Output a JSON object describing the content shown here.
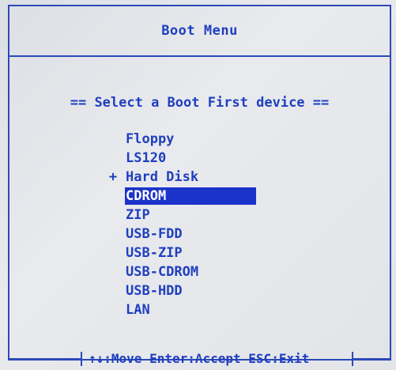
{
  "window": {
    "title": "Boot Menu"
  },
  "heading": "== Select a Boot First device ==",
  "devices": [
    {
      "label": "Floppy",
      "marker": ""
    },
    {
      "label": "LS120",
      "marker": ""
    },
    {
      "label": "Hard Disk",
      "marker": "+"
    },
    {
      "label": "CDROM",
      "marker": "",
      "selected": true
    },
    {
      "label": "ZIP",
      "marker": ""
    },
    {
      "label": "USB-FDD",
      "marker": ""
    },
    {
      "label": "USB-ZIP",
      "marker": ""
    },
    {
      "label": "USB-CDROM",
      "marker": ""
    },
    {
      "label": "USB-HDD",
      "marker": ""
    },
    {
      "label": "LAN",
      "marker": ""
    }
  ],
  "footer": {
    "help": "↑↓:Move Enter:Accept ESC:Exit"
  },
  "colors": {
    "text": "#1f3fbf",
    "highlight_bg": "#1a33c9",
    "highlight_text": "#ffffff",
    "border": "#2a49b8",
    "background": "#e4e6ea"
  }
}
